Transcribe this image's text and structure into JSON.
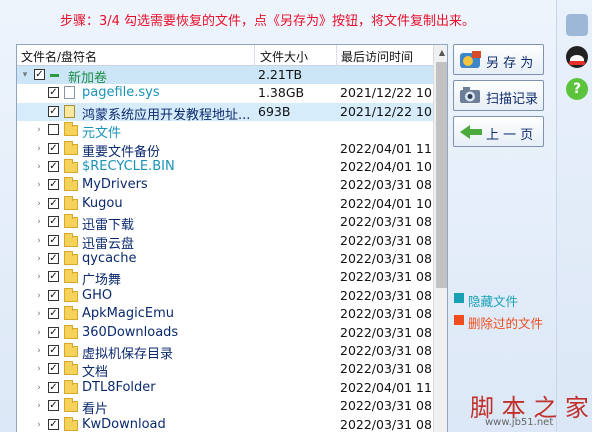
{
  "step_text": "步骤：3/4 勾选需要恢复的文件，点《另存为》按钮，将文件复制出来。",
  "columns": {
    "name": "文件名/盘符名",
    "size": "文件大小",
    "date": "最后访问时间"
  },
  "rows": [
    {
      "name": "新加卷",
      "size": "2.21TB",
      "date": "",
      "kind": "drive",
      "expander": "▾",
      "level": 0,
      "style": "drv",
      "selected": "sel1"
    },
    {
      "name": "pagefile.sys",
      "size": "1.38GB",
      "date": "2021/12/22 10:0",
      "kind": "file",
      "expander": "",
      "level": 1,
      "style": "hid",
      "selected": ""
    },
    {
      "name": "鸿蒙系统应用开发教程地址...",
      "size": "693B",
      "date": "2021/12/22 10:0",
      "kind": "file2",
      "expander": "",
      "level": 1,
      "style": "",
      "selected": "sel2"
    },
    {
      "name": "元文件",
      "size": "",
      "date": "",
      "kind": "folder",
      "expander": "›",
      "level": 1,
      "style": "hid",
      "selected": "",
      "nocheck": true
    },
    {
      "name": "重要文件备份",
      "size": "",
      "date": "2022/04/01 11:0",
      "kind": "folder",
      "expander": "›",
      "level": 1,
      "style": "",
      "selected": ""
    },
    {
      "name": "$RECYCLE.BIN",
      "size": "",
      "date": "2022/04/01 10:5",
      "kind": "folder",
      "expander": "›",
      "level": 1,
      "style": "hid",
      "selected": ""
    },
    {
      "name": "MyDrivers",
      "size": "",
      "date": "2022/03/31 08:2",
      "kind": "folder",
      "expander": "›",
      "level": 1,
      "style": "",
      "selected": ""
    },
    {
      "name": "Kugou",
      "size": "",
      "date": "2022/04/01 10:5",
      "kind": "folder",
      "expander": "›",
      "level": 1,
      "style": "",
      "selected": ""
    },
    {
      "name": "迅雷下载",
      "size": "",
      "date": "2022/03/31 08:2",
      "kind": "folder",
      "expander": "›",
      "level": 1,
      "style": "",
      "selected": ""
    },
    {
      "name": "迅雷云盘",
      "size": "",
      "date": "2022/03/31 08:2",
      "kind": "folder",
      "expander": "›",
      "level": 1,
      "style": "",
      "selected": ""
    },
    {
      "name": "qycache",
      "size": "",
      "date": "2022/03/31 08:2",
      "kind": "folder",
      "expander": "›",
      "level": 1,
      "style": "",
      "selected": ""
    },
    {
      "name": "广场舞",
      "size": "",
      "date": "2022/03/31 08:2",
      "kind": "folder",
      "expander": "›",
      "level": 1,
      "style": "",
      "selected": ""
    },
    {
      "name": "GHO",
      "size": "",
      "date": "2022/03/31 08:2",
      "kind": "folder",
      "expander": "›",
      "level": 1,
      "style": "",
      "selected": ""
    },
    {
      "name": "ApkMagicEmu",
      "size": "",
      "date": "2022/03/31 08:2",
      "kind": "folder",
      "expander": "›",
      "level": 1,
      "style": "",
      "selected": ""
    },
    {
      "name": "360Downloads",
      "size": "",
      "date": "2022/03/31 08:2",
      "kind": "folder",
      "expander": "›",
      "level": 1,
      "style": "",
      "selected": ""
    },
    {
      "name": "虚拟机保存目录",
      "size": "",
      "date": "2022/03/31 08:2",
      "kind": "folder",
      "expander": "›",
      "level": 1,
      "style": "",
      "selected": ""
    },
    {
      "name": "文档",
      "size": "",
      "date": "2022/03/31 08:2",
      "kind": "folder",
      "expander": "›",
      "level": 1,
      "style": "",
      "selected": ""
    },
    {
      "name": "DTL8Folder",
      "size": "",
      "date": "2022/04/01 11:0",
      "kind": "folder",
      "expander": "›",
      "level": 1,
      "style": "",
      "selected": ""
    },
    {
      "name": "看片",
      "size": "",
      "date": "2022/03/31 08:2",
      "kind": "folder",
      "expander": "›",
      "level": 1,
      "style": "",
      "selected": ""
    },
    {
      "name": "KwDownload",
      "size": "",
      "date": "2022/03/31 08:2",
      "kind": "folder",
      "expander": "›",
      "level": 1,
      "style": "",
      "selected": ""
    }
  ],
  "buttons": {
    "save_as": "另 存 为",
    "scan_record": "扫描记录",
    "prev": "上 一 页"
  },
  "legend": {
    "hidden": "隐藏文件",
    "deleted": "删除过的文件",
    "hidden_color": "#1aa0b4",
    "deleted_color": "#f04e1e"
  },
  "watermark": {
    "text": "脚 本 之 家",
    "url": "www.jb51.net"
  },
  "check_mark": "☑"
}
